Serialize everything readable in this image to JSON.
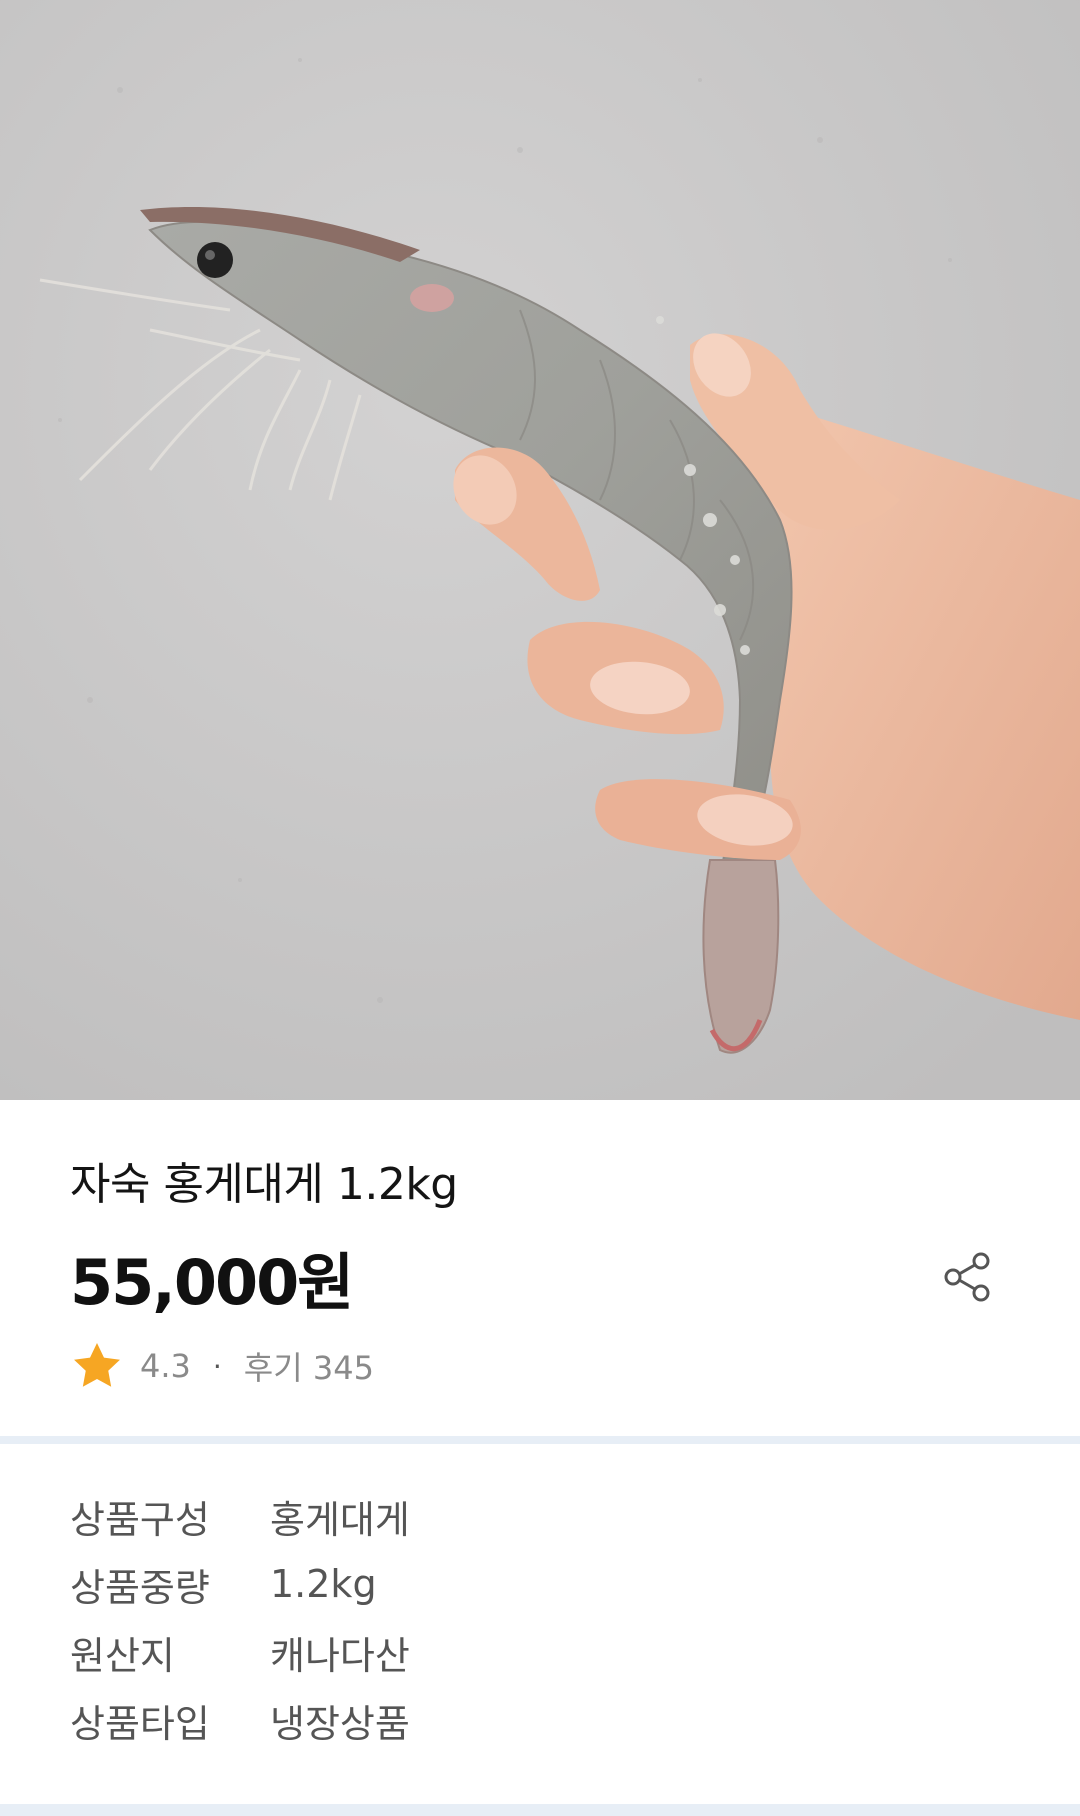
{
  "product": {
    "title": "자숙 홍게대게 1.2kg",
    "price": "55,000원",
    "rating": "4.3",
    "separator": "·",
    "reviews": "후기 345"
  },
  "specs": [
    {
      "label": "상품구성",
      "value": "홍게대게"
    },
    {
      "label": "상품중량",
      "value": "1.2kg"
    },
    {
      "label": "원산지",
      "value": "캐나다산"
    },
    {
      "label": "상품타입",
      "value": "냉장상품"
    }
  ],
  "icons": {
    "share": "share-icon",
    "star": "star-icon"
  },
  "colors": {
    "star": "#f6a623",
    "divider": "#e7eef6",
    "text_primary": "#111111",
    "text_secondary": "#8a8a8a"
  }
}
